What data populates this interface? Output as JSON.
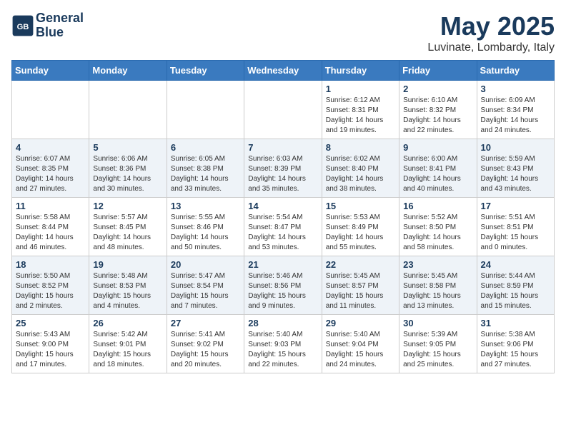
{
  "header": {
    "logo_line1": "General",
    "logo_line2": "Blue",
    "month_title": "May 2025",
    "location": "Luvinate, Lombardy, Italy"
  },
  "days_of_week": [
    "Sunday",
    "Monday",
    "Tuesday",
    "Wednesday",
    "Thursday",
    "Friday",
    "Saturday"
  ],
  "weeks": [
    [
      {
        "day": "",
        "info": ""
      },
      {
        "day": "",
        "info": ""
      },
      {
        "day": "",
        "info": ""
      },
      {
        "day": "",
        "info": ""
      },
      {
        "day": "1",
        "info": "Sunrise: 6:12 AM\nSunset: 8:31 PM\nDaylight: 14 hours\nand 19 minutes."
      },
      {
        "day": "2",
        "info": "Sunrise: 6:10 AM\nSunset: 8:32 PM\nDaylight: 14 hours\nand 22 minutes."
      },
      {
        "day": "3",
        "info": "Sunrise: 6:09 AM\nSunset: 8:34 PM\nDaylight: 14 hours\nand 24 minutes."
      }
    ],
    [
      {
        "day": "4",
        "info": "Sunrise: 6:07 AM\nSunset: 8:35 PM\nDaylight: 14 hours\nand 27 minutes."
      },
      {
        "day": "5",
        "info": "Sunrise: 6:06 AM\nSunset: 8:36 PM\nDaylight: 14 hours\nand 30 minutes."
      },
      {
        "day": "6",
        "info": "Sunrise: 6:05 AM\nSunset: 8:38 PM\nDaylight: 14 hours\nand 33 minutes."
      },
      {
        "day": "7",
        "info": "Sunrise: 6:03 AM\nSunset: 8:39 PM\nDaylight: 14 hours\nand 35 minutes."
      },
      {
        "day": "8",
        "info": "Sunrise: 6:02 AM\nSunset: 8:40 PM\nDaylight: 14 hours\nand 38 minutes."
      },
      {
        "day": "9",
        "info": "Sunrise: 6:00 AM\nSunset: 8:41 PM\nDaylight: 14 hours\nand 40 minutes."
      },
      {
        "day": "10",
        "info": "Sunrise: 5:59 AM\nSunset: 8:43 PM\nDaylight: 14 hours\nand 43 minutes."
      }
    ],
    [
      {
        "day": "11",
        "info": "Sunrise: 5:58 AM\nSunset: 8:44 PM\nDaylight: 14 hours\nand 46 minutes."
      },
      {
        "day": "12",
        "info": "Sunrise: 5:57 AM\nSunset: 8:45 PM\nDaylight: 14 hours\nand 48 minutes."
      },
      {
        "day": "13",
        "info": "Sunrise: 5:55 AM\nSunset: 8:46 PM\nDaylight: 14 hours\nand 50 minutes."
      },
      {
        "day": "14",
        "info": "Sunrise: 5:54 AM\nSunset: 8:47 PM\nDaylight: 14 hours\nand 53 minutes."
      },
      {
        "day": "15",
        "info": "Sunrise: 5:53 AM\nSunset: 8:49 PM\nDaylight: 14 hours\nand 55 minutes."
      },
      {
        "day": "16",
        "info": "Sunrise: 5:52 AM\nSunset: 8:50 PM\nDaylight: 14 hours\nand 58 minutes."
      },
      {
        "day": "17",
        "info": "Sunrise: 5:51 AM\nSunset: 8:51 PM\nDaylight: 15 hours\nand 0 minutes."
      }
    ],
    [
      {
        "day": "18",
        "info": "Sunrise: 5:50 AM\nSunset: 8:52 PM\nDaylight: 15 hours\nand 2 minutes."
      },
      {
        "day": "19",
        "info": "Sunrise: 5:48 AM\nSunset: 8:53 PM\nDaylight: 15 hours\nand 4 minutes."
      },
      {
        "day": "20",
        "info": "Sunrise: 5:47 AM\nSunset: 8:54 PM\nDaylight: 15 hours\nand 7 minutes."
      },
      {
        "day": "21",
        "info": "Sunrise: 5:46 AM\nSunset: 8:56 PM\nDaylight: 15 hours\nand 9 minutes."
      },
      {
        "day": "22",
        "info": "Sunrise: 5:45 AM\nSunset: 8:57 PM\nDaylight: 15 hours\nand 11 minutes."
      },
      {
        "day": "23",
        "info": "Sunrise: 5:45 AM\nSunset: 8:58 PM\nDaylight: 15 hours\nand 13 minutes."
      },
      {
        "day": "24",
        "info": "Sunrise: 5:44 AM\nSunset: 8:59 PM\nDaylight: 15 hours\nand 15 minutes."
      }
    ],
    [
      {
        "day": "25",
        "info": "Sunrise: 5:43 AM\nSunset: 9:00 PM\nDaylight: 15 hours\nand 17 minutes."
      },
      {
        "day": "26",
        "info": "Sunrise: 5:42 AM\nSunset: 9:01 PM\nDaylight: 15 hours\nand 18 minutes."
      },
      {
        "day": "27",
        "info": "Sunrise: 5:41 AM\nSunset: 9:02 PM\nDaylight: 15 hours\nand 20 minutes."
      },
      {
        "day": "28",
        "info": "Sunrise: 5:40 AM\nSunset: 9:03 PM\nDaylight: 15 hours\nand 22 minutes."
      },
      {
        "day": "29",
        "info": "Sunrise: 5:40 AM\nSunset: 9:04 PM\nDaylight: 15 hours\nand 24 minutes."
      },
      {
        "day": "30",
        "info": "Sunrise: 5:39 AM\nSunset: 9:05 PM\nDaylight: 15 hours\nand 25 minutes."
      },
      {
        "day": "31",
        "info": "Sunrise: 5:38 AM\nSunset: 9:06 PM\nDaylight: 15 hours\nand 27 minutes."
      }
    ]
  ]
}
